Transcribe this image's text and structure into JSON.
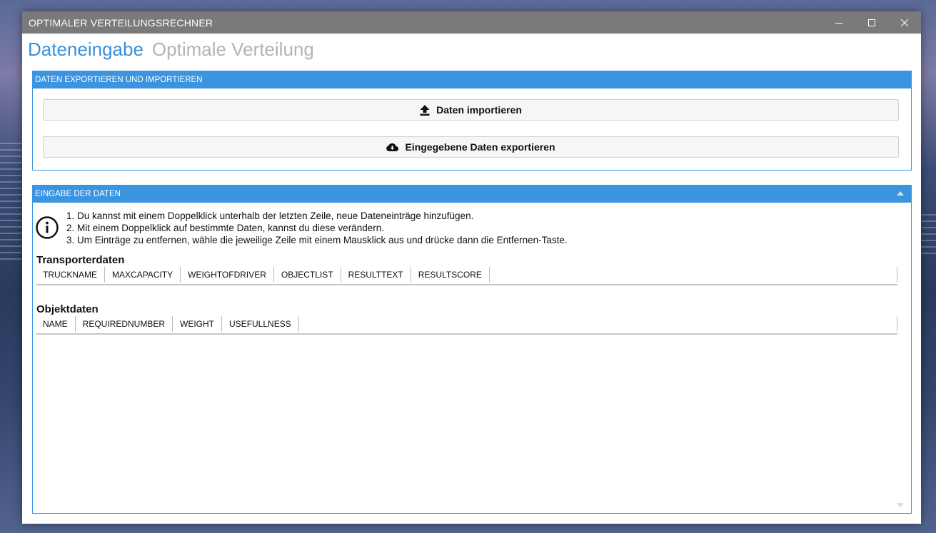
{
  "window": {
    "title": "OPTIMALER VERTEILUNGSRECHNER",
    "controls": [
      "minimize-icon",
      "maximize-icon",
      "close-icon"
    ]
  },
  "tabs": [
    {
      "label": "Dateneingabe",
      "active": true
    },
    {
      "label": "Optimale Verteilung",
      "active": false
    }
  ],
  "export_panel": {
    "header": "DATEN EXPORTIEREN UND IMPORTIEREN",
    "import_label": "Daten importieren",
    "import_icon": "upload-icon",
    "export_label": "Eingegebene Daten exportieren",
    "export_icon": "cloud-download-icon"
  },
  "input_panel": {
    "header": "EINGABE DER DATEN",
    "info_icon": "info-icon",
    "instructions": [
      "1. Du kannst mit einem Doppelklick unterhalb der letzten Zeile, neue Dateneinträge hinzufügen.",
      "2. Mit einem Doppelklick auf bestimmte Daten, kannst du diese verändern.",
      "3. Um Einträge zu entfernen, wähle die jeweilige Zeile mit einem Mausklick aus und drücke dann die Entfernen-Taste."
    ],
    "transporter": {
      "title": "Transporterdaten",
      "columns": [
        "TRUCKNAME",
        "MAXCAPACITY",
        "WEIGHTOFDRIVER",
        "OBJECTLIST",
        "RESULTTEXT",
        "RESULTSCORE"
      ]
    },
    "objects": {
      "title": "Objektdaten",
      "columns": [
        "NAME",
        "REQUIREDNUMBER",
        "WEIGHT",
        "USEFULLNESS"
      ]
    }
  },
  "colors": {
    "accent": "#3a94df",
    "titlebar": "#7a7a7a",
    "inactive_tab": "#b3b3b3"
  }
}
